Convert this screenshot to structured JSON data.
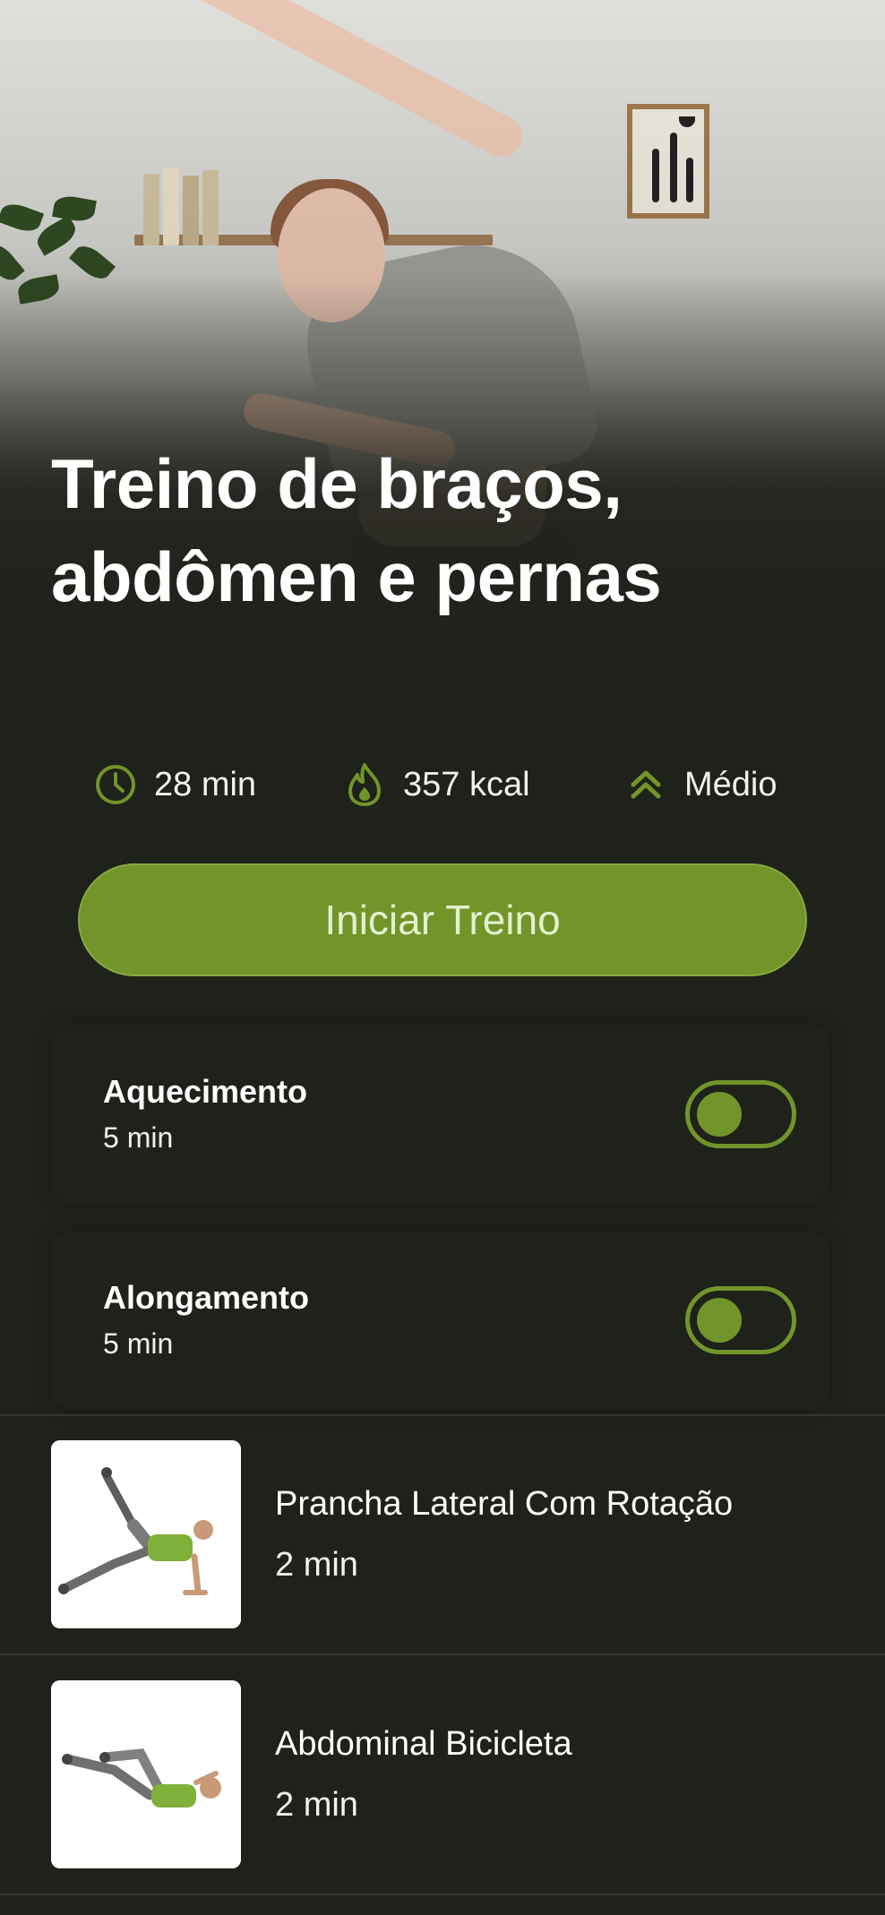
{
  "hero": {
    "title_line1": "Treino de braços,",
    "title_line2": "abdômen e pernas"
  },
  "stats": {
    "duration": "28 min",
    "calories": "357 kcal",
    "level": "Médio",
    "icons": [
      "clock-icon",
      "flame-icon",
      "double-chevron-up-icon"
    ]
  },
  "start_button": {
    "label": "Iniciar Treino"
  },
  "options": [
    {
      "title": "Aquecimento",
      "subtitle": "5 min",
      "enabled": true
    },
    {
      "title": "Alongamento",
      "subtitle": "5 min",
      "enabled": true
    }
  ],
  "exercises": [
    {
      "name": "Prancha Lateral Com Rotação",
      "duration": "2 min"
    },
    {
      "name": "Abdominal Bicicleta",
      "duration": "2 min"
    }
  ],
  "colors": {
    "background": "#1f211b",
    "accent": "#719529",
    "button_text": "#e4efcf"
  }
}
